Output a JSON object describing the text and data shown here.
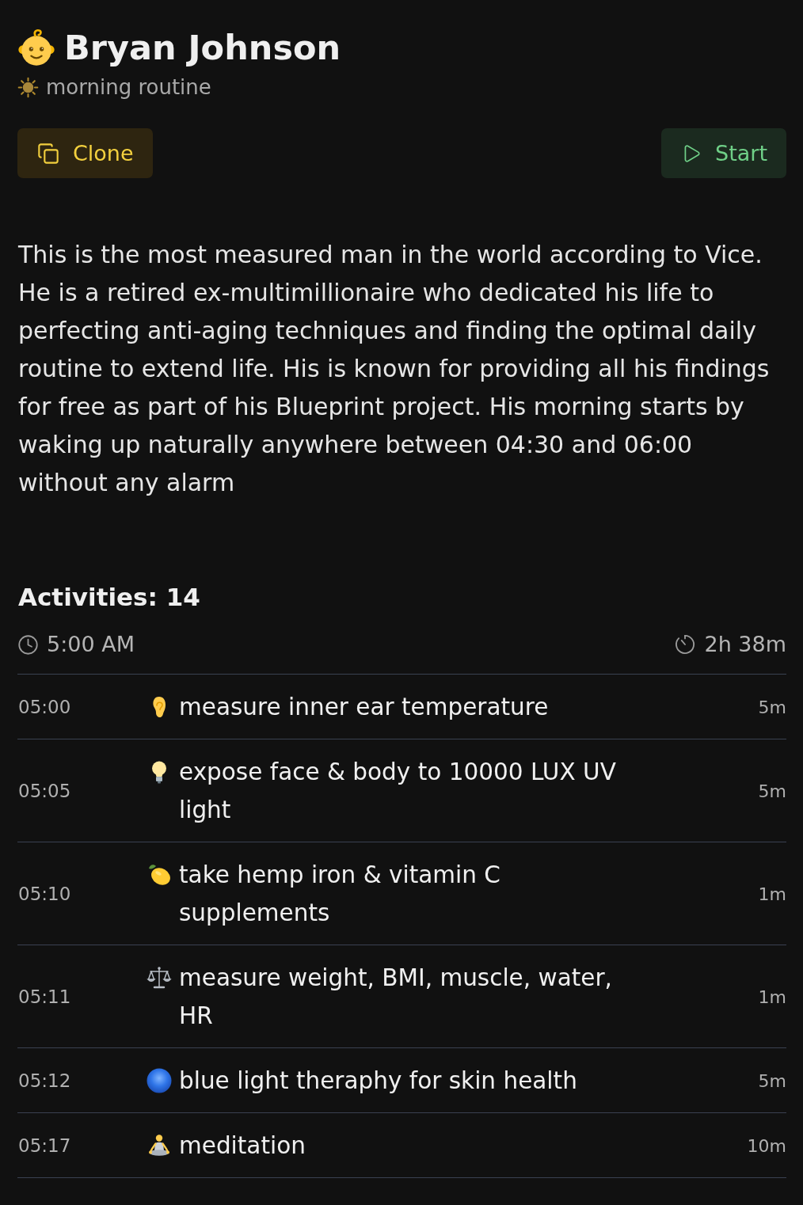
{
  "header": {
    "title": "Bryan Johnson",
    "subtitle": "morning routine"
  },
  "actions": [
    {
      "kind": "clone",
      "label": "Clone"
    },
    {
      "kind": "start",
      "label": "Start"
    }
  ],
  "description": "This is the most measured man in the world according to Vice. He is a retired ex-multimillionaire who dedicated his life to perfecting anti-aging techniques and finding the optimal daily routine to extend life. His is known for providing all his findings for free as part of his Blueprint project. His morning starts by waking up naturally anywhere between 04:30 and 06:00 without any alarm",
  "activities": {
    "heading": "Activities: 14",
    "start_time": "5:00 AM",
    "total_duration": "2h 38m",
    "items": [
      {
        "kind": "ear",
        "time": "05:00",
        "title": "measure inner ear temperature",
        "duration": "5m"
      },
      {
        "kind": "bulb",
        "time": "05:05",
        "title": "expose face & body to 10000 LUX UV light",
        "duration": "5m"
      },
      {
        "kind": "lemon",
        "time": "05:10",
        "title": "take hemp iron & vitamin C supplements",
        "duration": "1m"
      },
      {
        "kind": "scales",
        "time": "05:11",
        "title": "measure weight, BMI, muscle, water, HR",
        "duration": "1m"
      },
      {
        "kind": "circle",
        "time": "05:12",
        "title": "blue light theraphy for skin health",
        "duration": "5m"
      },
      {
        "kind": "meditation",
        "time": "05:17",
        "title": "meditation",
        "duration": "10m"
      }
    ]
  }
}
